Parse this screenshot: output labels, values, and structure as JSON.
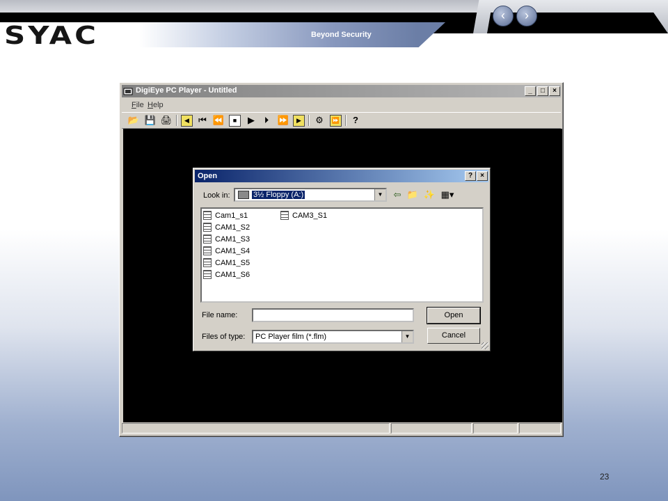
{
  "slide": {
    "logo": "SYAC",
    "tagline": "Beyond Security",
    "page_number": "23"
  },
  "player_window": {
    "title": "DigiEye PC Player - Untitled",
    "menu": [
      "File",
      "Help"
    ],
    "title_buttons": [
      "_",
      "□",
      "×"
    ],
    "toolbar": {
      "open": "📂",
      "save": "💾",
      "print": "🖨",
      "prev_file": "◀",
      "first": "⏮",
      "rewind": "⏪",
      "stop": "■",
      "play": "▶",
      "step": "⏵",
      "fast_forward": "⏩",
      "next_file": "▶",
      "camera": "⚙",
      "sync": "⏩",
      "help": "?"
    }
  },
  "open_dialog": {
    "title": "Open",
    "title_buttons": [
      "?",
      "×"
    ],
    "look_in_label": "Look in:",
    "look_in_value": "3½ Floppy (A:)",
    "files": [
      "Cam1_s1",
      "CAM1_S2",
      "CAM1_S3",
      "CAM1_S4",
      "CAM1_S5",
      "CAM1_S6",
      "CAM3_S1"
    ],
    "file_name_label": "File name:",
    "file_name_value": "",
    "files_of_type_label": "Files of type:",
    "files_of_type_value": "PC Player film (*.flm)",
    "open_button": "Open",
    "cancel_button": "Cancel"
  },
  "colors": {
    "dialog_title_start": "#0a246a",
    "dialog_title_end": "#a6caf0",
    "window_face": "#d4d0c8",
    "video_area": "#000000"
  }
}
